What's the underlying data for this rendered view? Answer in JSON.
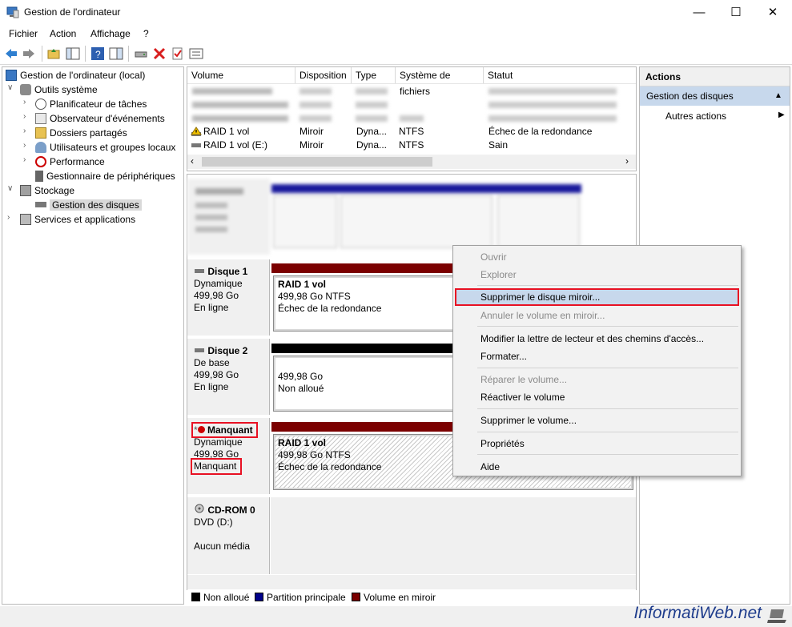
{
  "window": {
    "title": "Gestion de l'ordinateur"
  },
  "menu": {
    "items": [
      "Fichier",
      "Action",
      "Affichage",
      "?"
    ]
  },
  "tree": {
    "root": "Gestion de l'ordinateur (local)",
    "system_tools": "Outils système",
    "task_scheduler": "Planificateur de tâches",
    "event_viewer": "Observateur d'événements",
    "shared_folders": "Dossiers partagés",
    "local_users": "Utilisateurs et groupes locaux",
    "performance": "Performance",
    "device_manager": "Gestionnaire de périphériques",
    "storage": "Stockage",
    "disk_management": "Gestion des disques",
    "services_apps": "Services et applications"
  },
  "volumes": {
    "headers": [
      "Volume",
      "Disposition",
      "Type",
      "Système de fichiers",
      "Statut"
    ],
    "rows": [
      {
        "volume": "RAID 1 vol",
        "layout": "Miroir",
        "type": "Dyna...",
        "fs": "NTFS",
        "status": "Échec de la redondance"
      },
      {
        "volume": "RAID 1 vol (E:)",
        "layout": "Miroir",
        "type": "Dyna...",
        "fs": "NTFS",
        "status": "Sain"
      }
    ]
  },
  "disks": {
    "disk1": {
      "name": "Disque 1",
      "kind": "Dynamique",
      "size": "499,98 Go",
      "state": "En ligne",
      "part_name": "RAID 1 vol",
      "part_size": "499,98 Go NTFS",
      "part_status": "Échec de la redondance"
    },
    "disk2": {
      "name": "Disque 2",
      "kind": "De base",
      "size": "499,98 Go",
      "state": "En ligne",
      "part_size": "499,98 Go",
      "part_status": "Non alloué"
    },
    "missing": {
      "name": "Manquant",
      "kind": "Dynamique",
      "size": "499,98 Go",
      "state": "Manquant",
      "part_name": "RAID 1 vol",
      "part_size": "499,98 Go NTFS",
      "part_status": "Échec de la redondance"
    },
    "cdrom": {
      "name": "CD-ROM 0",
      "kind": "DVD (D:)",
      "state": "Aucun média"
    }
  },
  "legend": {
    "unallocated": "Non alloué",
    "primary": "Partition principale",
    "mirror": "Volume en miroir"
  },
  "actions": {
    "header": "Actions",
    "section": "Gestion des disques",
    "more": "Autres actions"
  },
  "context_menu": {
    "open": "Ouvrir",
    "explore": "Explorer",
    "remove_mirror": "Supprimer le disque miroir...",
    "break_mirror": "Annuler le volume en miroir...",
    "change_letter": "Modifier la lettre de lecteur et des chemins d'accès...",
    "format": "Formater...",
    "repair": "Réparer le volume...",
    "reactivate": "Réactiver le volume",
    "delete": "Supprimer le volume...",
    "properties": "Propriétés",
    "help": "Aide"
  },
  "watermark": "InformatiWeb.net",
  "colors": {
    "mirror": "#7b0000",
    "primary": "#00008b",
    "unallocated": "#000000",
    "highlight_border": "#e81123",
    "selection": "#c7d8ec"
  }
}
